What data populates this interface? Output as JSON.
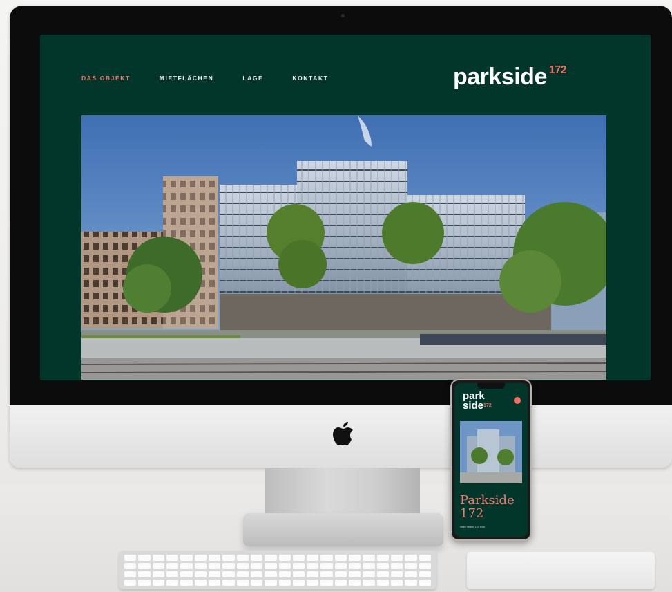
{
  "website": {
    "nav": [
      {
        "label": "DAS OBJEKT",
        "active": true
      },
      {
        "label": "MIETFLÄCHEN",
        "active": false
      },
      {
        "label": "LAGE",
        "active": false
      },
      {
        "label": "KONTAKT",
        "active": false
      }
    ],
    "brand": {
      "name": "parkside",
      "number": "172"
    },
    "colors": {
      "background": "#03362a",
      "accent": "#ef6f62",
      "text": "#ffffff"
    }
  },
  "mobile": {
    "brand_line1": "park",
    "brand_line2": "side",
    "brand_number": "172",
    "title_line1": "Parkside",
    "title_line2": "172",
    "footer_text": "Ihnen Straße 172, Köln"
  },
  "icons": [
    "apple-logo-icon",
    "menu-icon"
  ]
}
